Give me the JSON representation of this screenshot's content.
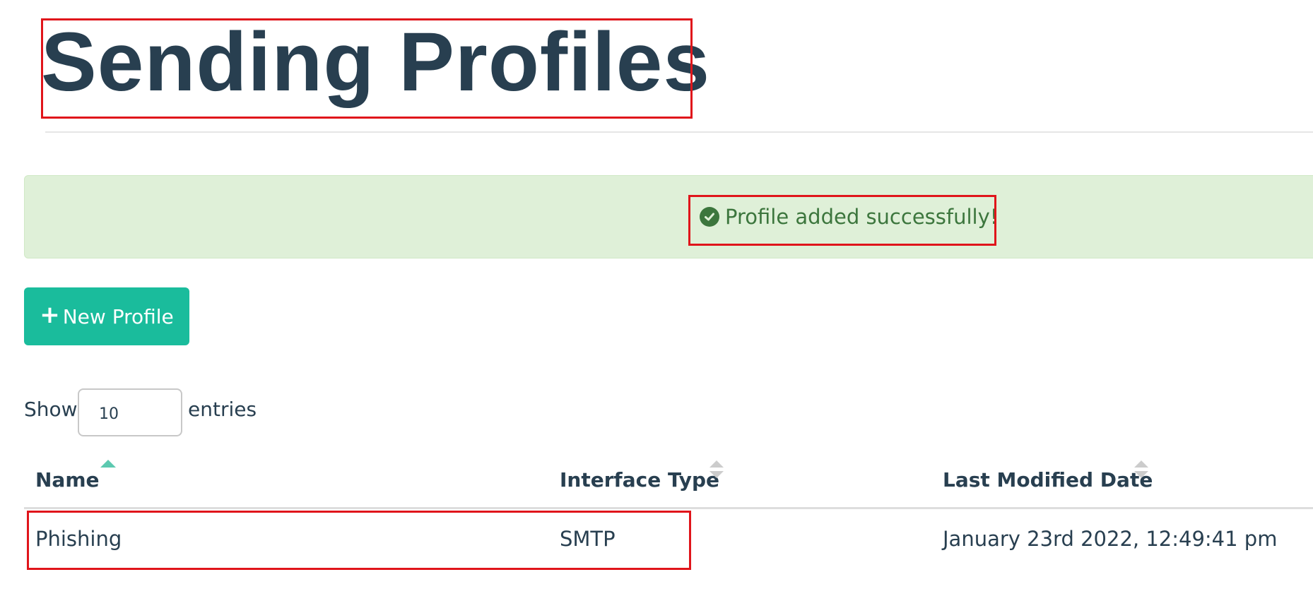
{
  "page": {
    "title": "Sending Profiles"
  },
  "alert": {
    "message": "Profile added successfully!",
    "icon": "check-circle-icon",
    "text_color": "#3c763d",
    "background": "#dff0d8"
  },
  "toolbar": {
    "new_profile_label": "New Profile",
    "new_profile_icon": "plus-icon",
    "button_color": "#1abc9c"
  },
  "length_menu": {
    "prefix": "Show",
    "selected_value": "10",
    "suffix": "entries"
  },
  "table": {
    "columns": [
      {
        "label": "Name",
        "sort": "ascending"
      },
      {
        "label": "Interface Type",
        "sort": "none"
      },
      {
        "label": "Last Modified Date",
        "sort": "none"
      }
    ],
    "rows": [
      {
        "name": "Phishing",
        "interface_type": "SMTP",
        "last_modified": "January 23rd 2022, 12:49:41 pm"
      }
    ]
  },
  "highlight_color": "#e0151b"
}
